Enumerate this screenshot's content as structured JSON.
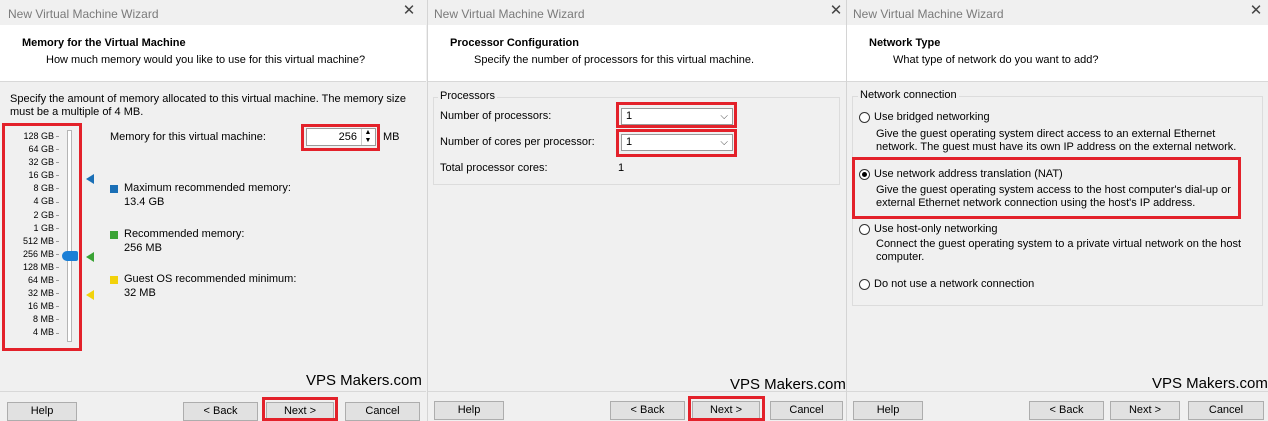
{
  "window_title": "New Virtual Machine Wizard",
  "watermark": "VPS Makers.com",
  "buttons": {
    "help": "Help",
    "back": "< Back",
    "next": "Next >",
    "cancel": "Cancel"
  },
  "memory": {
    "title": "Memory for the Virtual Machine",
    "subtitle": "How much memory would you like to use for this virtual machine?",
    "intro_line1": "Specify the amount of memory allocated to this virtual machine. The memory size",
    "intro_line2": "must be a multiple of 4 MB.",
    "scale": [
      "128 GB",
      "64 GB",
      "32 GB",
      "16 GB",
      "8 GB",
      "4 GB",
      "2 GB",
      "1 GB",
      "512 MB",
      "256 MB",
      "128 MB",
      "64 MB",
      "32 MB",
      "16 MB",
      "8 MB",
      "4 MB"
    ],
    "field_label": "Memory for this virtual machine:",
    "field_value": "256",
    "field_unit": "MB",
    "max_label": "Maximum recommended memory:",
    "max_value": "13.4 GB",
    "rec_label": "Recommended memory:",
    "rec_value": "256 MB",
    "min_label": "Guest OS recommended minimum:",
    "min_value": "32 MB",
    "colors": {
      "max": "#1a6fb6",
      "rec": "#3aa335",
      "min": "#f2d20a",
      "highlight": "#e3212a"
    }
  },
  "processor": {
    "title": "Processor Configuration",
    "subtitle": "Specify the number of processors for this virtual machine.",
    "group_label": "Processors",
    "num_processors_label": "Number of processors:",
    "num_processors_value": "1",
    "cores_label": "Number of cores per processor:",
    "cores_value": "1",
    "total_label": "Total processor cores:",
    "total_value": "1"
  },
  "network": {
    "title": "Network Type",
    "subtitle": "What type of network do you want to add?",
    "group_label": "Network connection",
    "options": [
      {
        "label": "Use bridged networking",
        "desc1": "Give the guest operating system direct access to an external Ethernet",
        "desc2": "network. The guest must have its own IP address on the external network.",
        "selected": false
      },
      {
        "label": "Use network address translation (NAT)",
        "desc1": "Give the guest operating system access to the host computer's dial-up or",
        "desc2": "external Ethernet network connection using the host's IP address.",
        "selected": true
      },
      {
        "label": "Use host-only networking",
        "desc1": "Connect the guest operating system to a private virtual network on the host",
        "desc2": "computer.",
        "selected": false
      },
      {
        "label": "Do not use a network connection",
        "desc1": "",
        "desc2": "",
        "selected": false
      }
    ]
  }
}
